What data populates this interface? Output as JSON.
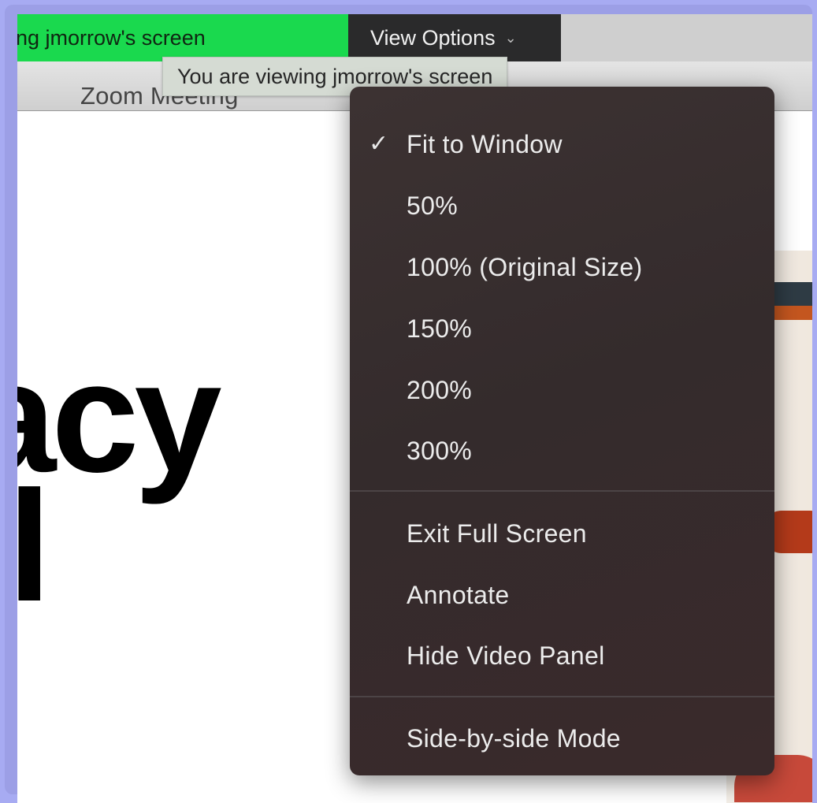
{
  "share_banner": {
    "text": "ng jmorrow's screen"
  },
  "view_options": {
    "label": "View Options",
    "chevron_icon": "chevron-down-icon"
  },
  "tooltip": {
    "text": "You are viewing jmorrow's screen"
  },
  "window": {
    "title": "Zoom Meeting"
  },
  "slide": {
    "line1": "acy",
    "line2": "ll"
  },
  "menu": {
    "items": [
      {
        "label": "Fit to Window",
        "checked": true
      },
      {
        "label": "50%",
        "checked": false
      },
      {
        "label": "100% (Original Size)",
        "checked": false
      },
      {
        "label": "150%",
        "checked": false
      },
      {
        "label": "200%",
        "checked": false
      },
      {
        "label": "300%",
        "checked": false
      },
      {
        "label": "Exit Full Screen",
        "checked": false
      },
      {
        "label": "Annotate",
        "checked": false
      },
      {
        "label": "Hide Video Panel",
        "checked": false
      },
      {
        "label": "Side-by-side Mode",
        "checked": false
      }
    ],
    "check_icon": "checkmark-icon",
    "check_glyph": "✓"
  },
  "colors": {
    "banner_green": "#1ad94e",
    "menu_bg": "#352c2d",
    "button_bg": "#2a2a2b"
  }
}
